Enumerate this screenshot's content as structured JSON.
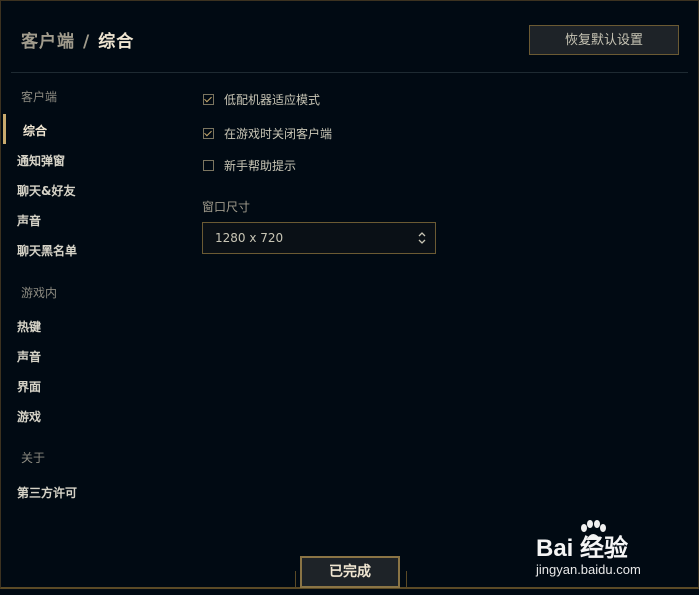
{
  "header": {
    "breadcrumb_parent": "客户端",
    "breadcrumb_separator": "/",
    "breadcrumb_current": "综合",
    "reset_button": "恢复默认设置"
  },
  "sidebar": {
    "sections": [
      {
        "title": "客户端",
        "items": [
          {
            "label": "综合",
            "active": true
          },
          {
            "label": "通知弹窗"
          },
          {
            "label": "聊天&好友"
          },
          {
            "label": "声音"
          },
          {
            "label": "聊天黑名单"
          }
        ]
      },
      {
        "title": "游戏内",
        "items": [
          {
            "label": "热键"
          },
          {
            "label": "声音"
          },
          {
            "label": "界面"
          },
          {
            "label": "游戏"
          }
        ]
      },
      {
        "title": "关于",
        "items": [
          {
            "label": "第三方许可"
          }
        ]
      }
    ]
  },
  "options": [
    {
      "label": "低配机器适应模式",
      "checked": true
    },
    {
      "label": "在游戏时关闭客户端",
      "checked": true
    },
    {
      "label": "新手帮助提示",
      "checked": false
    }
  ],
  "window_size": {
    "label": "窗口尺寸",
    "selected": "1280 x 720"
  },
  "footer": {
    "done_button": "已完成"
  },
  "watermark": {
    "logo_text": "Bai 经验",
    "url": "jingyan.baidu.com"
  },
  "colors": {
    "accent_gold": "#c8aa6e",
    "background": "#010a13",
    "border_gold": "#6b5a33"
  }
}
